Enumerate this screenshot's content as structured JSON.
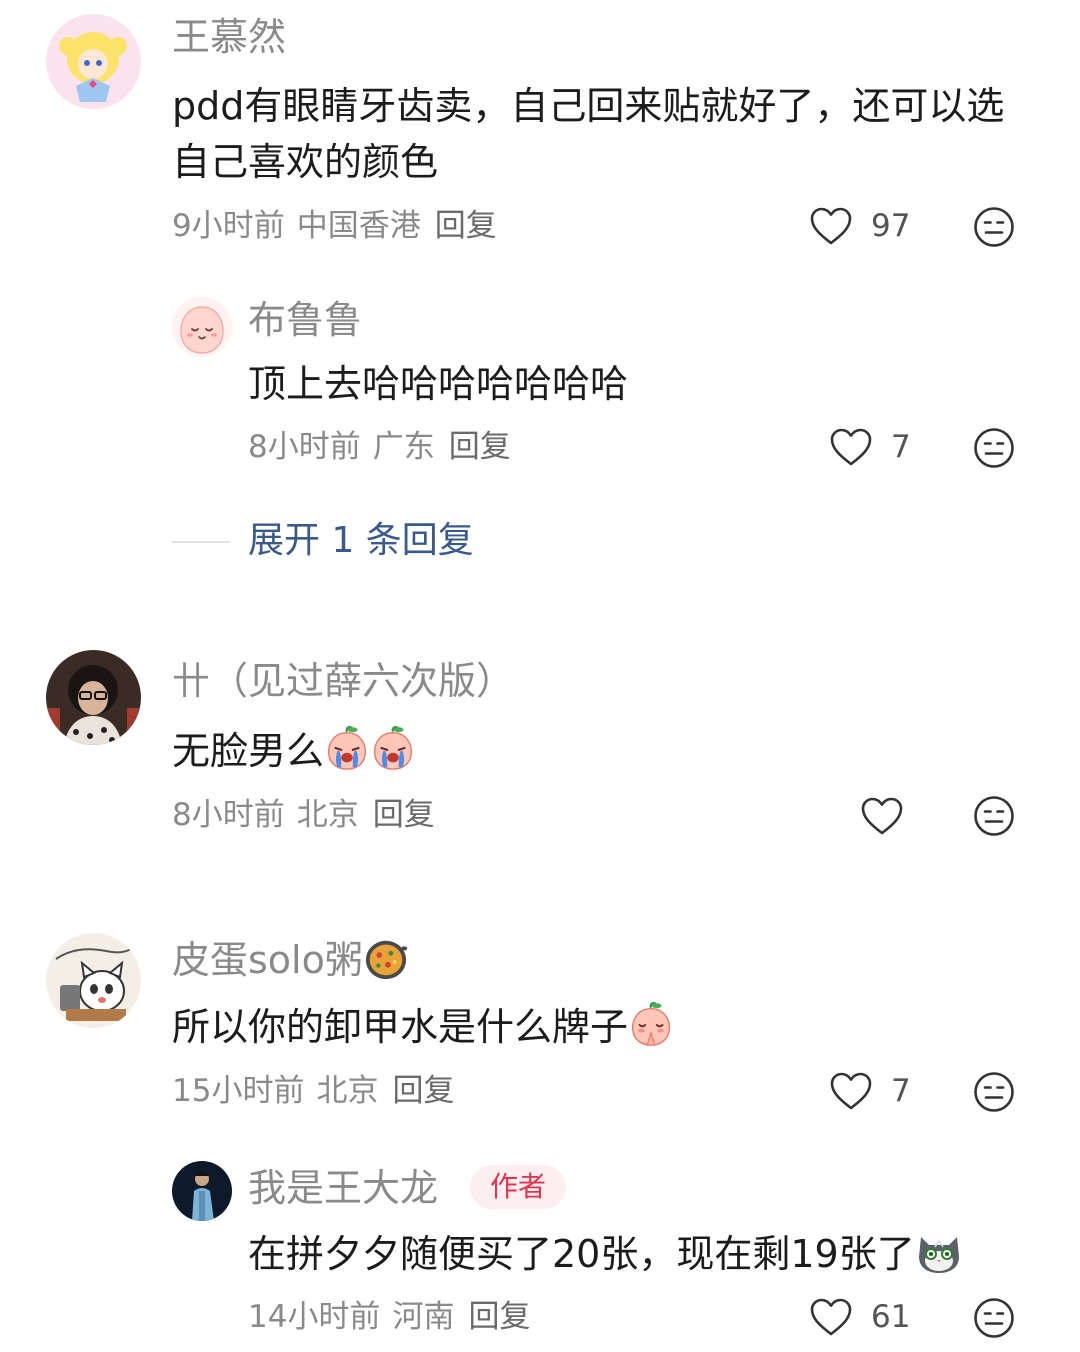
{
  "comments": [
    {
      "user": "王慕然",
      "text": "pdd有眼睛牙齿卖，自己回来贴就好了，还可以选自己喜欢的颜色",
      "time": "9小时前",
      "location": "中国香港",
      "reply_label": "回复",
      "likes": "97",
      "replies": [
        {
          "user": "布鲁鲁",
          "text": "顶上去哈哈哈哈哈哈哈",
          "time": "8小时前",
          "location": "广东",
          "reply_label": "回复",
          "likes": "7"
        }
      ],
      "expand_label": "展开 1 条回复"
    },
    {
      "user": "卄（见过薛六次版）",
      "text": "无脸男么",
      "time": "8小时前",
      "location": "北京",
      "reply_label": "回复",
      "likes": ""
    },
    {
      "user": "皮蛋solo粥",
      "text": "所以你的卸甲水是什么牌子",
      "time": "15小时前",
      "location": "北京",
      "reply_label": "回复",
      "likes": "7",
      "replies": [
        {
          "user": "我是王大龙",
          "badge": "作者",
          "text": "在拼夕夕随便买了20张，现在剩19张了",
          "time": "14小时前",
          "location": "河南",
          "reply_label": "回复",
          "likes": "61"
        }
      ]
    }
  ],
  "icons": {
    "like": "heart-outline-icon",
    "react": "neutral-face-icon",
    "emoji_crying": "crying-peach-emoji",
    "emoji_praying": "praying-peach-emoji",
    "emoji_food": "paella-pan-emoji",
    "emoji_cat": "cat-face-emoji"
  },
  "colors": {
    "expand_link": "#3a5a8c",
    "author_badge_text": "#e0344f",
    "author_badge_bg": "#fdeef0"
  }
}
